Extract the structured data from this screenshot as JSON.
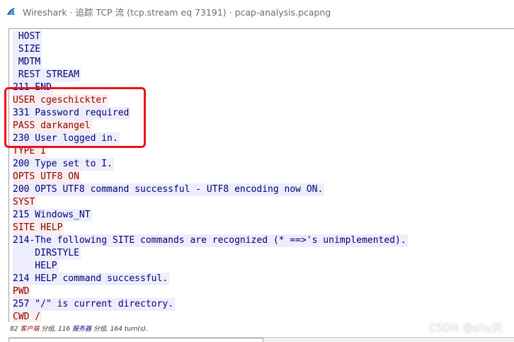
{
  "window": {
    "title": "Wireshark · 追踪 TCP 流 (tcp.stream eq 73191) · pcap-analysis.pcapng",
    "app_icon": "wireshark-fin-icon"
  },
  "stream": {
    "lines": [
      {
        "text": " HOST",
        "dir": "server"
      },
      {
        "text": " SIZE",
        "dir": "server"
      },
      {
        "text": " MDTM",
        "dir": "server"
      },
      {
        "text": " REST STREAM",
        "dir": "server"
      },
      {
        "text": "211 END",
        "dir": "server"
      },
      {
        "text": "USER cgeschickter",
        "dir": "client"
      },
      {
        "text": "331 Password required",
        "dir": "server"
      },
      {
        "text": "PASS darkangel",
        "dir": "client"
      },
      {
        "text": "230 User logged in.",
        "dir": "server"
      },
      {
        "text": "TYPE I",
        "dir": "client"
      },
      {
        "text": "200 Type set to I.",
        "dir": "server"
      },
      {
        "text": "OPTS UTF8 ON",
        "dir": "client"
      },
      {
        "text": "200 OPTS UTF8 command successful - UTF8 encoding now ON.",
        "dir": "server"
      },
      {
        "text": "SYST",
        "dir": "client"
      },
      {
        "text": "215 Windows_NT",
        "dir": "server"
      },
      {
        "text": "SITE HELP",
        "dir": "client"
      },
      {
        "text": "214-The following SITE commands are recognized (* ==>'s unimplemented).",
        "dir": "server"
      },
      {
        "text": "    DIRSTYLE",
        "dir": "server"
      },
      {
        "text": "    HELP",
        "dir": "server"
      },
      {
        "text": "214 HELP command successful.",
        "dir": "server"
      },
      {
        "text": "PWD",
        "dir": "client"
      },
      {
        "text": "257 \"/\" is current directory.",
        "dir": "server"
      },
      {
        "text": "CWD /",
        "dir": "client"
      }
    ],
    "client_color": "#8b0000",
    "server_color": "#00007a",
    "annotation_color": "#e8141b"
  },
  "status": {
    "client_count": "82",
    "client_label": "客户端",
    "sep1": "分组,",
    "server_count": "116",
    "server_label": "服务器",
    "sep2": "分组,",
    "turns": "164 turn(s)."
  },
  "watermark": "CSDN @shu天"
}
